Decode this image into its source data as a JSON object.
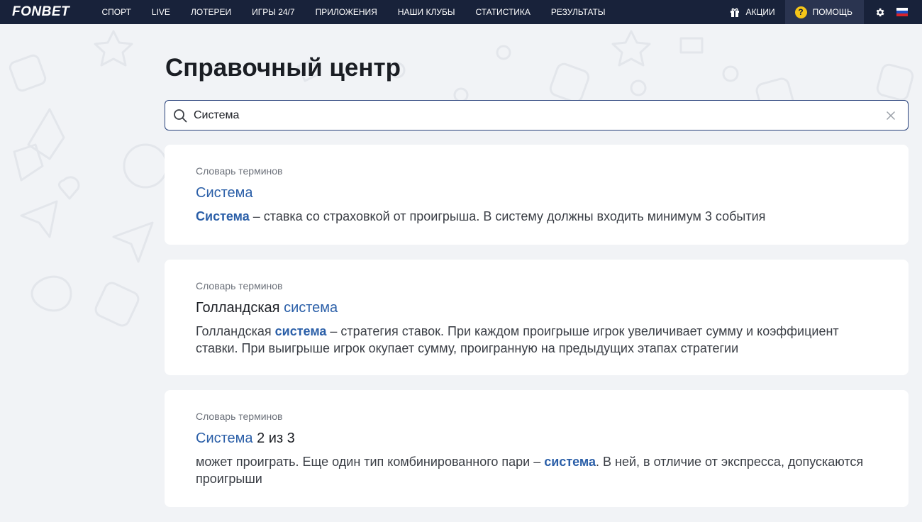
{
  "header": {
    "logo": "FONBET",
    "nav": [
      "СПОРТ",
      "LIVE",
      "ЛОТЕРЕИ",
      "ИГРЫ 24/7",
      "ПРИЛОЖЕНИЯ",
      "НАШИ КЛУБЫ",
      "СТАТИСТИКА",
      "РЕЗУЛЬТАТЫ"
    ],
    "promo_label": "АКЦИИ",
    "help_label": "ПОМОЩЬ",
    "help_icon_glyph": "?",
    "colors": {
      "bar": "#18223a",
      "help_bg": "#2a3450",
      "help_icon": "#f5c518"
    }
  },
  "page": {
    "title": "Справочный центр"
  },
  "search": {
    "value": "Система",
    "icon": "search-icon",
    "clear_icon": "close-icon"
  },
  "results": [
    {
      "category": "Словарь терминов",
      "title": [
        {
          "text": "Система",
          "hl": true
        }
      ],
      "snippet": [
        {
          "text": "Система",
          "hl": true
        },
        {
          "text": " – ставка со страховкой от проигрыша. В систему должны входить минимум 3 события",
          "hl": false
        }
      ]
    },
    {
      "category": "Словарь терминов",
      "title": [
        {
          "text": "Голландская ",
          "hl": false
        },
        {
          "text": "система",
          "hl": true
        }
      ],
      "snippet": [
        {
          "text": "Голландская ",
          "hl": false
        },
        {
          "text": "система",
          "hl": true
        },
        {
          "text": " – стратегия ставок. При каждом проигрыше игрок увеличивает сумму и коэффициент ставки. При выигрыше игрок окупает сумму, проигранную на предыдущих этапах стратегии",
          "hl": false
        }
      ]
    },
    {
      "category": "Словарь терминов",
      "title": [
        {
          "text": "Система",
          "hl": true
        },
        {
          "text": " 2 из 3",
          "hl": false
        }
      ],
      "snippet": [
        {
          "text": "может проиграть. Еще один тип комбинированного пари – ",
          "hl": false
        },
        {
          "text": "система",
          "hl": true
        },
        {
          "text": ". В ней, в отличие от экспресса, допускаются проигрыши",
          "hl": false
        }
      ]
    }
  ],
  "colors": {
    "accent": "#2b5fa8",
    "page_bg": "#f1f3f6",
    "card_bg": "#ffffff"
  }
}
